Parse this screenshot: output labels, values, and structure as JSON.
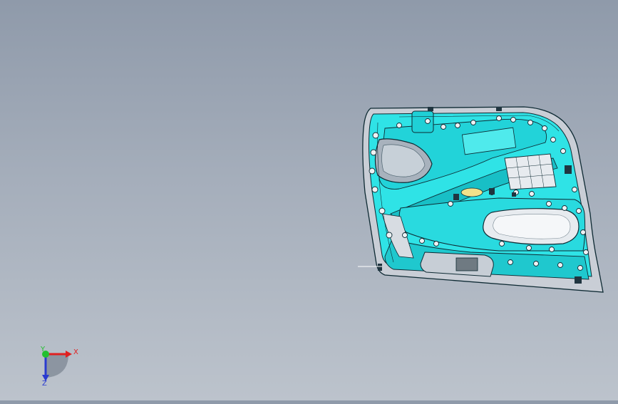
{
  "viewport": {
    "model": "door-trim-panel",
    "colors": {
      "background_top": "#8f9aaa",
      "background_bottom": "#bcc3cc",
      "part_fill": "#2fe3e6",
      "part_shade": "#18bfc6",
      "part_edge": "#0e2a33",
      "frame_fill": "#c9ced6",
      "window_fill": "#e7ebef",
      "clip_fill": "#eef2f4",
      "highlight": "#f2e28a"
    }
  },
  "triad": {
    "x_label": "X",
    "y_label": "Y",
    "z_label": "Z",
    "colors": {
      "x": "#e02020",
      "y": "#22c030",
      "z": "#2a3bd0"
    }
  }
}
